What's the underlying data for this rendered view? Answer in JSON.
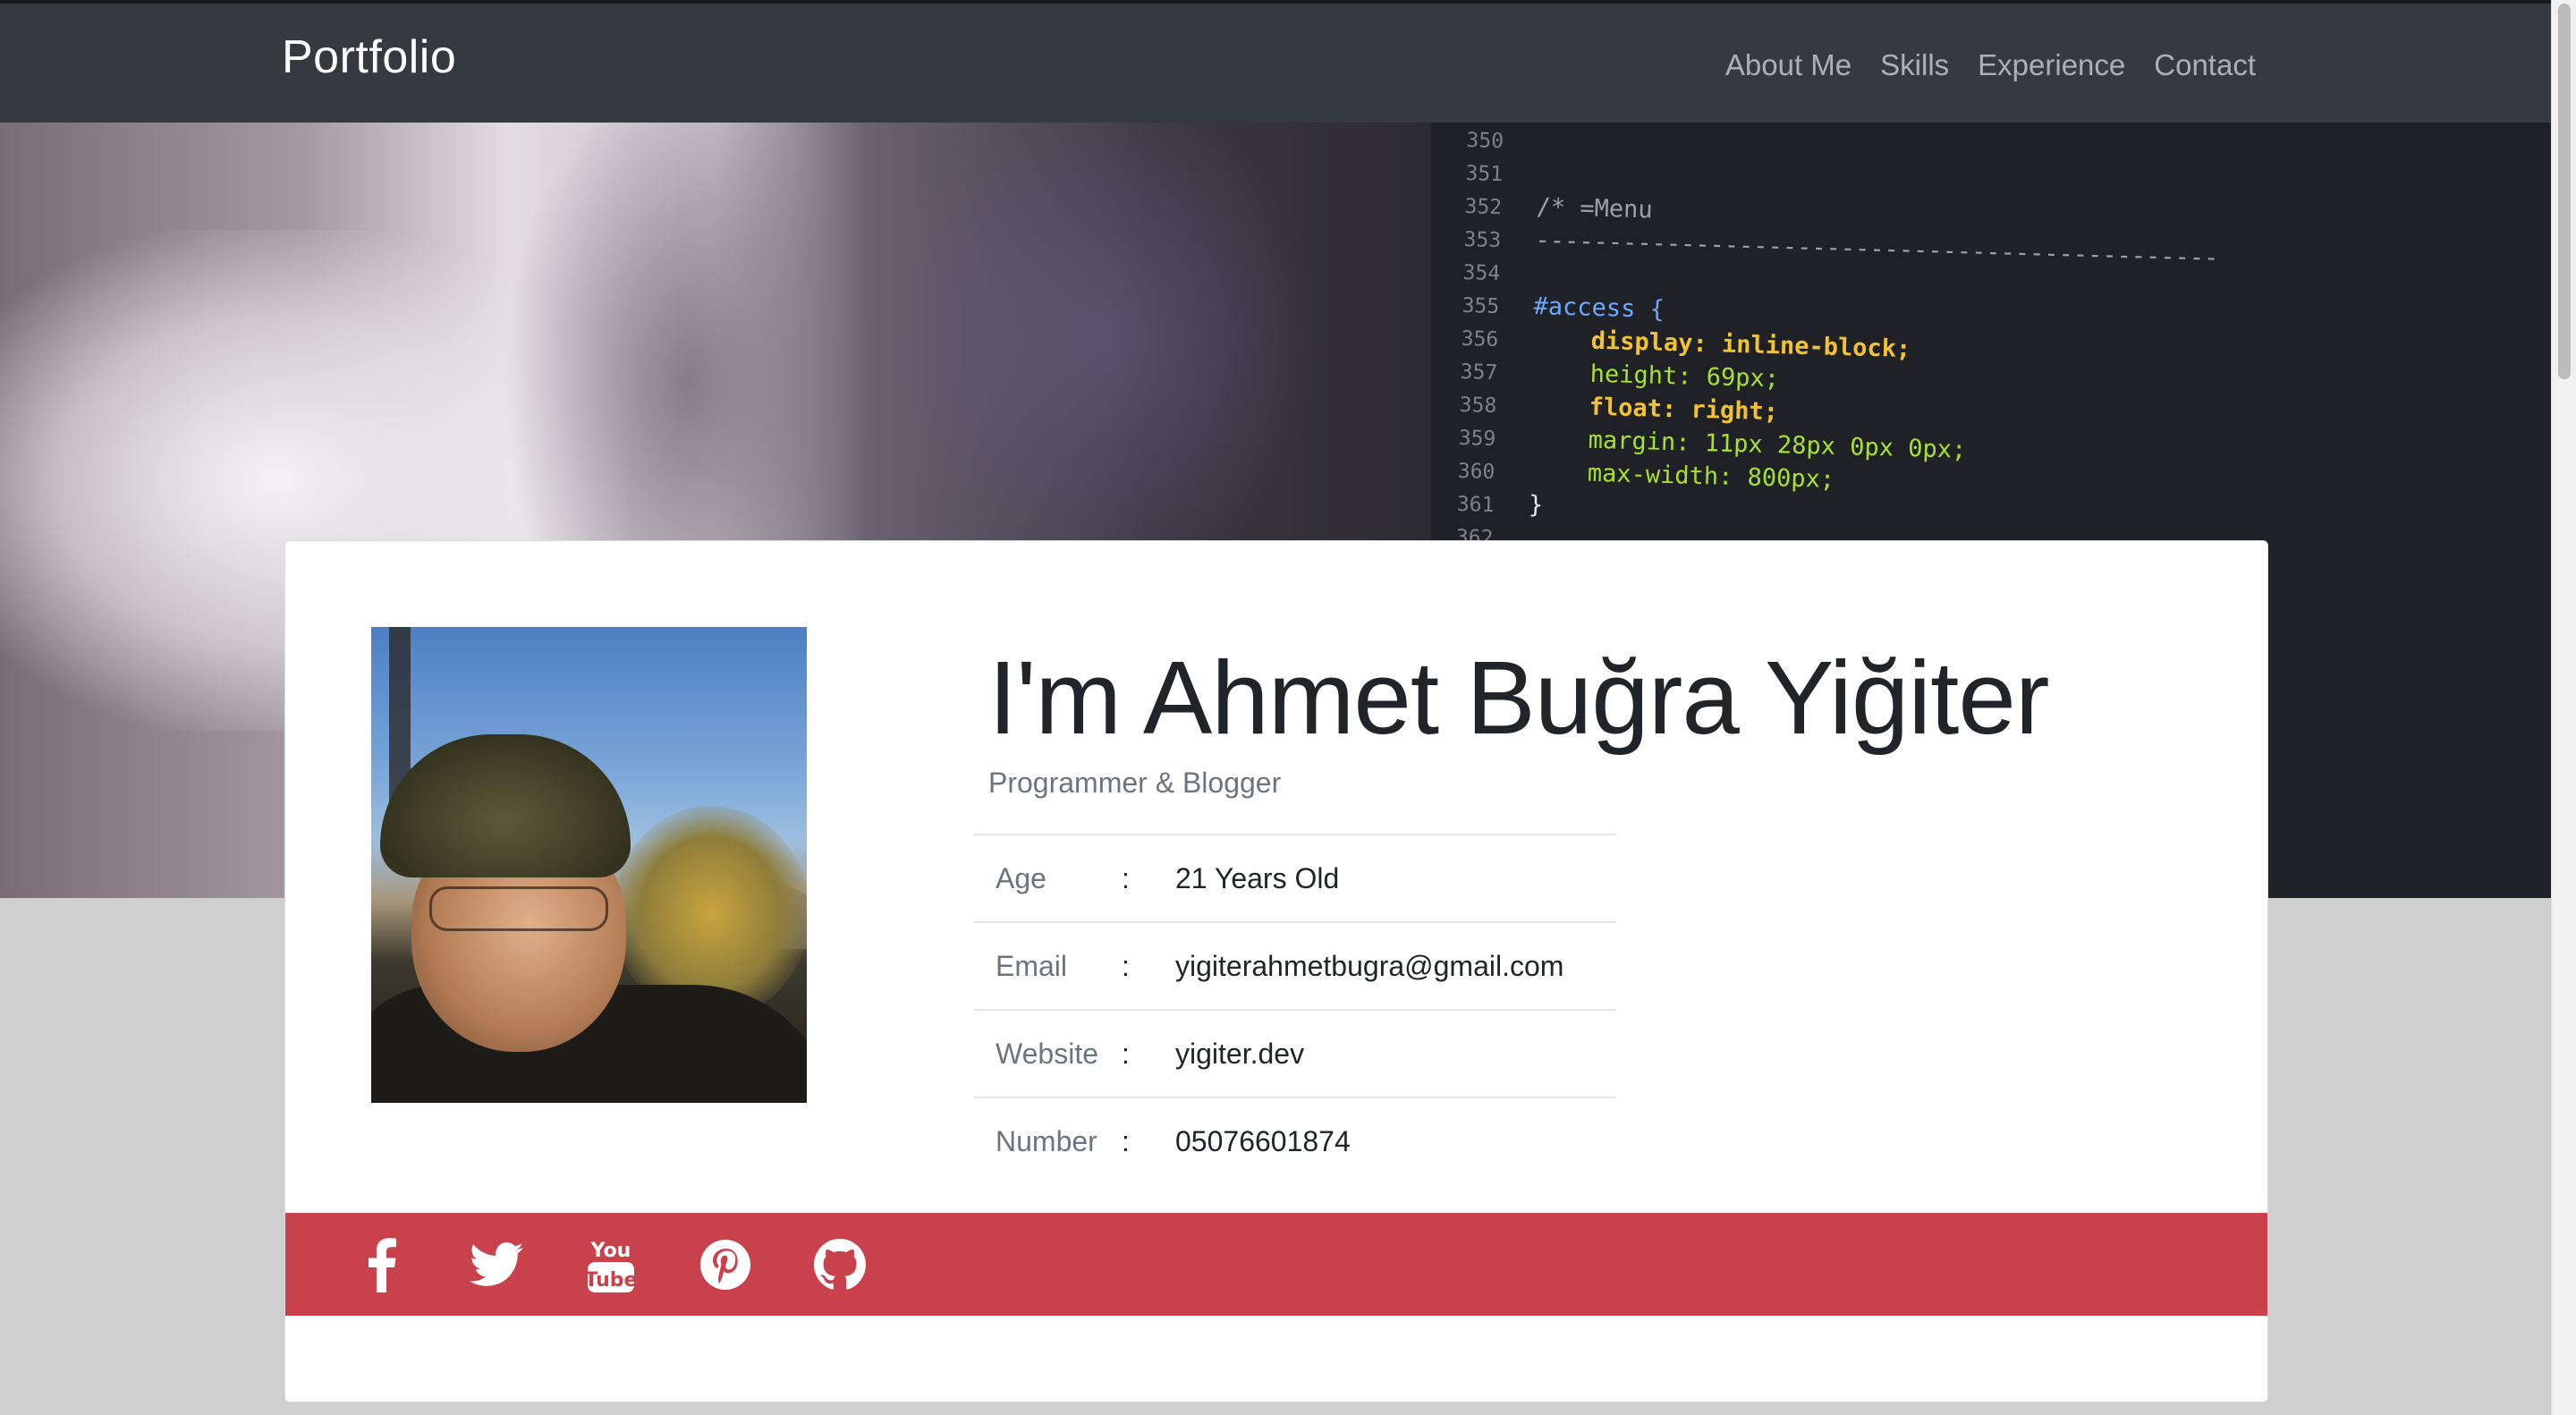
{
  "navbar": {
    "brand": "Portfolio",
    "links": [
      "About Me",
      "Skills",
      "Experience",
      "Contact"
    ]
  },
  "hero": {
    "code_lines": [
      {
        "num": "350",
        "text": ""
      },
      {
        "num": "351",
        "text": ""
      },
      {
        "num": "352",
        "text": "/* =Menu"
      },
      {
        "num": "353",
        "text": "-----------------------------------------------"
      },
      {
        "num": "354",
        "text": ""
      },
      {
        "num": "355",
        "text": "#access {"
      },
      {
        "num": "356",
        "text": "    display: inline-block;"
      },
      {
        "num": "357",
        "text": "    height: 69px;"
      },
      {
        "num": "358",
        "text": "    float: right;"
      },
      {
        "num": "359",
        "text": "    margin: 11px 28px 0px 0px;"
      },
      {
        "num": "360",
        "text": "    max-width: 800px;"
      },
      {
        "num": "361",
        "text": "}"
      },
      {
        "num": "362",
        "text": ""
      }
    ]
  },
  "profile": {
    "name": "I'm Ahmet Buğra Yiğiter",
    "subtitle": "Programmer & Blogger",
    "separator": ":",
    "info": [
      {
        "label": "Age",
        "value": "21 Years Old"
      },
      {
        "label": "Email",
        "value": "yigiterahmetbugra@gmail.com"
      },
      {
        "label": "Website",
        "value": "yigiter.dev"
      },
      {
        "label": "Number",
        "value": "05076601874"
      }
    ]
  },
  "social": {
    "color": "#c9424b",
    "icons": [
      "facebook-icon",
      "twitter-icon",
      "youtube-icon",
      "pinterest-icon",
      "github-icon"
    ],
    "youtube_text": [
      "You",
      "Tube"
    ]
  },
  "colors": {
    "navbar": "#343a40",
    "page_bg": "#cfcfcf",
    "social_bar": "#c9424b"
  }
}
